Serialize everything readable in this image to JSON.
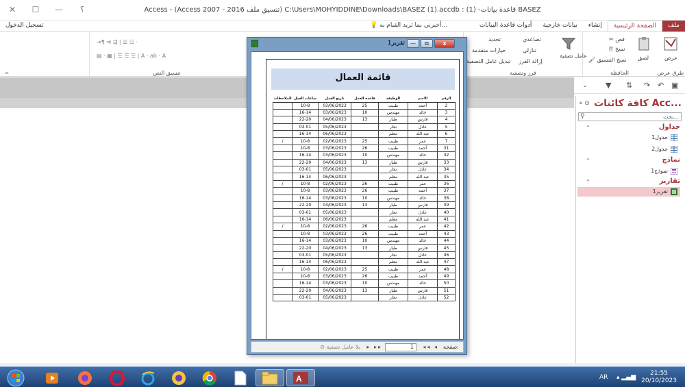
{
  "window": {
    "title": "Access - (Access 2007 - 2016 تنسيق ملف) C:\\Users\\MOHYIDDINE\\Downloads\\BASEZ (1).accdb : قاعدة بيانات- (1) BASEZ",
    "controls": [
      "✕",
      "☐",
      "—",
      "؟"
    ]
  },
  "tabs": {
    "file": "ملف",
    "home": "الصفحة الرئيسية",
    "create": "إنشاء",
    "external": "بيانات خارجية",
    "dbtools": "أدوات قاعدة البيانات",
    "tellme": "أخبرني بما تريد القيام به...",
    "signin": "تسجيل الدخول"
  },
  "ribbon": {
    "views_label": "طرق عرض",
    "view_btn": "عرض",
    "clipboard_label": "الحافظة",
    "paste_btn": "لصق",
    "cut_btn": "قص",
    "copy_btn": "نسخ",
    "format_painter": "نسخ التنسيق",
    "sortfilter_label": "فرز وتصفية",
    "filter_btn": "عامل تصفية",
    "ascending": "تصاعدي",
    "descending": "تنازلي",
    "remove_sort": "إزالة الفرز",
    "selection": "تحديد",
    "advanced": "خيارات متقدمة",
    "toggle_filter": "تبديل عامل التصفية",
    "text_format_label": "تنسيق النص"
  },
  "qat": {
    "icons": [
      "save-icon",
      "undo-icon",
      "redo-icon",
      "sort-icon",
      "filter-icon",
      "dropdown-icon"
    ]
  },
  "nav": {
    "header": "كافة كائنات Acc...",
    "search_placeholder": "بحث...",
    "groups": [
      {
        "label": "جداول",
        "items": [
          "جدول1",
          "جدول2"
        ]
      },
      {
        "label": "نماذج",
        "items": [
          "نموذج1"
        ]
      },
      {
        "label": "تقارير",
        "items": [
          "تقرير1"
        ]
      }
    ]
  },
  "report": {
    "window_title": "تقرير1",
    "title": "قائمة العمال",
    "columns": [
      "الرقم",
      "الاسم",
      "الوظيفة",
      "قاعدة العمل",
      "تاريخ العمل",
      "ساعات العمل",
      "الملاحظات"
    ],
    "rows": [
      [
        "2",
        "أحمد",
        "طبيب",
        "25",
        "03/06/2023",
        "10-8",
        ""
      ],
      [
        "3",
        "خالد",
        "مهندس",
        "10",
        "03/06/2023",
        "16-14",
        ""
      ],
      [
        "4",
        "فارس",
        "طيار",
        "13",
        "04/06/2023",
        "22-20",
        ""
      ],
      [
        "5",
        "عادل",
        "نجار",
        "",
        "05/06/2023",
        "03-01",
        ""
      ],
      [
        "6",
        "عبد الله",
        "معلم",
        "",
        "06/06/2023",
        "16-14",
        ""
      ],
      [
        "7",
        "عمر",
        "طبيب",
        "25",
        "02/06/2023",
        "10-8",
        "/"
      ],
      [
        "31",
        "أحمد",
        "طبيب",
        "26",
        "03/06/2023",
        "10-8",
        ""
      ],
      [
        "32",
        "خالد",
        "مهندس",
        "10",
        "03/06/2023",
        "16-14",
        ""
      ],
      [
        "33",
        "فارس",
        "طيار",
        "13",
        "04/06/2023",
        "22-20",
        ""
      ],
      [
        "34",
        "عادل",
        "نجار",
        "",
        "05/06/2023",
        "03-01",
        ""
      ],
      [
        "35",
        "عبد الله",
        "معلم",
        "",
        "06/06/2023",
        "16-14",
        ""
      ],
      [
        "36",
        "عمر",
        "طبيب",
        "26",
        "02/06/2023",
        "10-8",
        "/"
      ],
      [
        "37",
        "أحمد",
        "طبيب",
        "26",
        "03/06/2023",
        "10-8",
        ""
      ],
      [
        "38",
        "خالد",
        "مهندس",
        "10",
        "03/06/2023",
        "16-14",
        ""
      ],
      [
        "39",
        "فارس",
        "طيار",
        "13",
        "04/06/2023",
        "22-20",
        ""
      ],
      [
        "40",
        "عادل",
        "نجار",
        "",
        "05/06/2023",
        "03-01",
        ""
      ],
      [
        "41",
        "عبد الله",
        "معلم",
        "",
        "06/06/2023",
        "16-14",
        ""
      ],
      [
        "42",
        "عمر",
        "طبيب",
        "26",
        "02/06/2023",
        "10-8",
        "/"
      ],
      [
        "43",
        "أحمد",
        "طبيب",
        "26",
        "03/06/2023",
        "10-8",
        ""
      ],
      [
        "44",
        "خالد",
        "مهندس",
        "10",
        "03/06/2023",
        "16-14",
        ""
      ],
      [
        "45",
        "فارس",
        "طيار",
        "13",
        "04/06/2023",
        "22-20",
        ""
      ],
      [
        "46",
        "عادل",
        "نجار",
        "",
        "05/06/2023",
        "03-01",
        ""
      ],
      [
        "47",
        "عبد الله",
        "معلم",
        "",
        "06/06/2023",
        "16-14",
        ""
      ],
      [
        "48",
        "عمر",
        "طبيب",
        "25",
        "02/06/2023",
        "10-8",
        "/"
      ],
      [
        "49",
        "أحمد",
        "طبيب",
        "26",
        "03/06/2023",
        "10-8",
        ""
      ],
      [
        "50",
        "خالد",
        "مهندس",
        "10",
        "03/06/2023",
        "16-14",
        ""
      ],
      [
        "51",
        "فارس",
        "طيار",
        "13",
        "04/06/2023",
        "22-20",
        ""
      ],
      [
        "52",
        "عادل",
        "نجار",
        "",
        "05/06/2023",
        "03-01",
        ""
      ]
    ],
    "status": {
      "page_label": "صفحة:",
      "page_value": "1",
      "filter_label": "بلا عامل تصفية"
    }
  },
  "taskbar": {
    "lang": "AR",
    "time": "21:55",
    "date": "20/10/2023"
  },
  "colors": {
    "accent": "#a4373a",
    "header_fill": "#cfdcf0",
    "taskbar": "#2a5288"
  }
}
